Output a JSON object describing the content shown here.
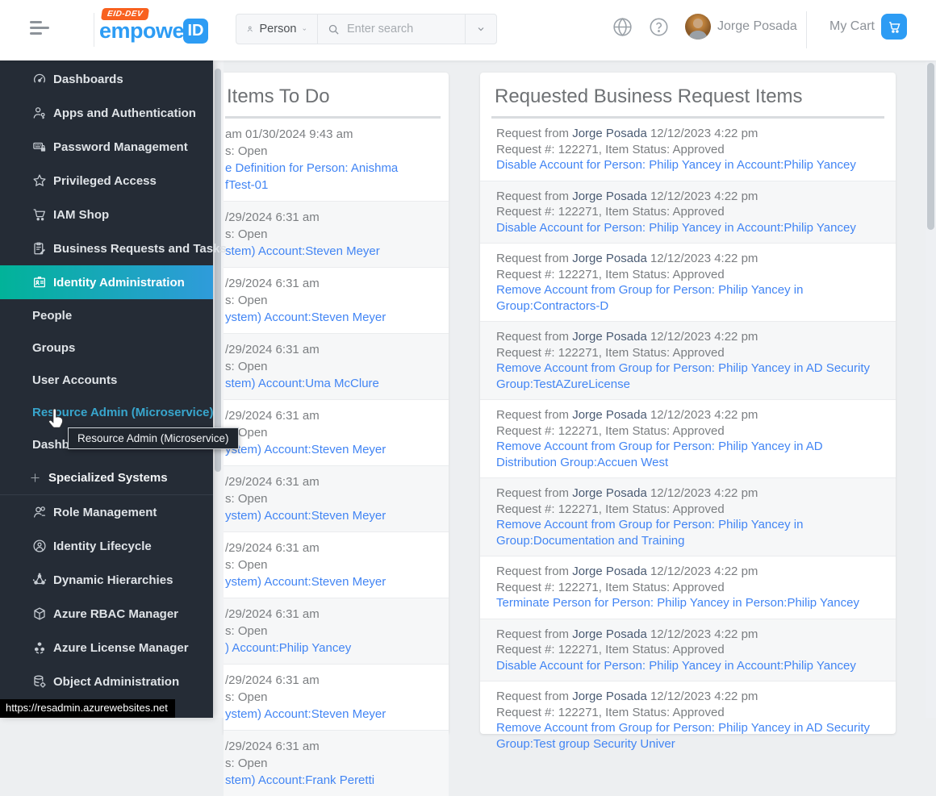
{
  "navbar": {
    "logo_badge": "EID-DEV",
    "logo_text": "empower",
    "logo_id": "ID",
    "person_filter_label": "Person",
    "search_placeholder": "Enter search",
    "user_name": "Jorge Posada",
    "my_cart_label": "My Cart"
  },
  "sidebar": {
    "items": [
      {
        "label": "Dashboards",
        "icon": "gauge-icon"
      },
      {
        "label": "Apps and Authentication",
        "icon": "user-key-icon"
      },
      {
        "label": "Password Management",
        "icon": "keyboard-lock-icon"
      },
      {
        "label": "Privileged Access",
        "icon": "star-icon"
      },
      {
        "label": "IAM Shop",
        "icon": "cart-icon"
      },
      {
        "label": "Business Requests and Tasks",
        "icon": "clipboard-icon"
      },
      {
        "label": "Identity Administration",
        "icon": "id-badge-icon",
        "active": true,
        "children": [
          {
            "label": "People"
          },
          {
            "label": "Groups"
          },
          {
            "label": "User Accounts"
          },
          {
            "label": "Resource Admin (Microservice)",
            "hovered": true
          },
          {
            "label": "Dashboards"
          },
          {
            "label": "Specialized Systems",
            "expandable": true
          }
        ]
      },
      {
        "label": "Role Management",
        "icon": "user-badge-icon",
        "section_start": true
      },
      {
        "label": "Identity Lifecycle",
        "icon": "user-lifecycle-icon"
      },
      {
        "label": "Dynamic Hierarchies",
        "icon": "hierarchy-icon"
      },
      {
        "label": "Azure RBAC Manager",
        "icon": "cube-icon"
      },
      {
        "label": "Azure License Manager",
        "icon": "cubes-icon"
      },
      {
        "label": "Object Administration",
        "icon": "database-gear-icon"
      }
    ],
    "tooltip": "Resource Admin (Microservice)",
    "status_url": "https://resadmin.azurewebsites.net"
  },
  "todo_panel": {
    "title": "Items To Do",
    "rows": [
      {
        "time": "am 01/30/2024 9:43 am",
        "status": "s: Open",
        "link_lines": [
          "e Definition for Person: Anishma",
          "fTest-01"
        ]
      },
      {
        "time": "/29/2024 6:31 am",
        "status": "s: Open",
        "link_lines": [
          "stem) Account:Steven Meyer"
        ]
      },
      {
        "time": "/29/2024 6:31 am",
        "status": "s: Open",
        "link_lines": [
          "ystem) Account:Steven Meyer"
        ]
      },
      {
        "time": "/29/2024 6:31 am",
        "status": "s: Open",
        "link_lines": [
          "stem) Account:Uma McClure"
        ]
      },
      {
        "time": "/29/2024 6:31 am",
        "status": "s: Open",
        "link_lines": [
          "ystem) Account:Steven Meyer"
        ]
      },
      {
        "time": "/29/2024 6:31 am",
        "status": "s: Open",
        "link_lines": [
          "ystem) Account:Steven Meyer"
        ]
      },
      {
        "time": "/29/2024 6:31 am",
        "status": "s: Open",
        "link_lines": [
          "ystem) Account:Steven Meyer"
        ]
      },
      {
        "time": "/29/2024 6:31 am",
        "status": "s: Open",
        "link_lines": [
          ") Account:Philip Yancey"
        ]
      },
      {
        "time": "/29/2024 6:31 am",
        "status": "s: Open",
        "link_lines": [
          "ystem) Account:Steven Meyer"
        ]
      },
      {
        "time": "/29/2024 6:31 am",
        "status": "s: Open",
        "link_lines": [
          "stem) Account:Frank Peretti"
        ]
      }
    ]
  },
  "requests_panel": {
    "title": "Requested Business Request Items",
    "from_label": "Request from",
    "rows": [
      {
        "from": "Jorge Posada",
        "date": "12/12/2023 4:22 pm",
        "meta": "Request #: 122271, Item Status: Approved",
        "link": "Disable Account for Person: Philip Yancey in Account:Philip Yancey"
      },
      {
        "from": "Jorge Posada",
        "date": "12/12/2023 4:22 pm",
        "meta": "Request #: 122271, Item Status: Approved",
        "link": "Disable Account for Person: Philip Yancey in Account:Philip Yancey"
      },
      {
        "from": "Jorge Posada",
        "date": "12/12/2023 4:22 pm",
        "meta": "Request #: 122271, Item Status: Approved",
        "link": "Remove Account from Group for Person: Philip Yancey in Group:Contractors-D"
      },
      {
        "from": "Jorge Posada",
        "date": "12/12/2023 4:22 pm",
        "meta": "Request #: 122271, Item Status: Approved",
        "link": "Remove Account from Group for Person: Philip Yancey in AD Security Group:TestAZureLicense"
      },
      {
        "from": "Jorge Posada",
        "date": "12/12/2023 4:22 pm",
        "meta": "Request #: 122271, Item Status: Approved",
        "link": "Remove Account from Group for Person: Philip Yancey in AD Distribution Group:Accuen West"
      },
      {
        "from": "Jorge Posada",
        "date": "12/12/2023 4:22 pm",
        "meta": "Request #: 122271, Item Status: Approved",
        "link": "Remove Account from Group for Person: Philip Yancey in Group:Documentation and Training"
      },
      {
        "from": "Jorge Posada",
        "date": "12/12/2023 4:22 pm",
        "meta": "Request #: 122271, Item Status: Approved",
        "link": "Terminate Person for Person: Philip Yancey in Person:Philip Yancey"
      },
      {
        "from": "Jorge Posada",
        "date": "12/12/2023 4:22 pm",
        "meta": "Request #: 122271, Item Status: Approved",
        "link": "Disable Account for Person: Philip Yancey in Account:Philip Yancey"
      },
      {
        "from": "Jorge Posada",
        "date": "12/12/2023 4:22 pm",
        "meta": "Request #: 122271, Item Status: Approved",
        "link": "Remove Account from Group for Person: Philip Yancey in AD Security Group:Test group Security Univer"
      }
    ]
  },
  "colors": {
    "accent_blue": "#2d9cf4",
    "link_blue": "#4285f4",
    "name_link": "#4a5b73",
    "badge_orange": "#f8611f",
    "sidebar_bg": "#252c36",
    "active_gradient_start": "#01b399",
    "active_gradient_end": "#2f9bdb"
  }
}
